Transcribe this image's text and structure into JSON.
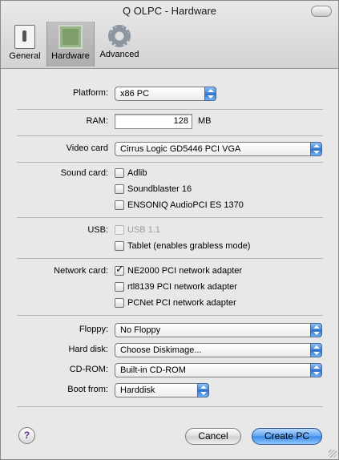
{
  "window": {
    "title": "Q OLPC - Hardware"
  },
  "toolbar": {
    "items": [
      {
        "label": "General",
        "icon": "switch-icon"
      },
      {
        "label": "Hardware",
        "icon": "chip-icon",
        "active": true
      },
      {
        "label": "Advanced",
        "icon": "gear-icon"
      }
    ]
  },
  "form": {
    "platform": {
      "label": "Platform:",
      "value": "x86 PC"
    },
    "ram": {
      "label": "RAM:",
      "value": "128",
      "unit": "MB"
    },
    "video": {
      "label": "Video card",
      "value": "Cirrus Logic GD5446 PCI VGA"
    },
    "sound": {
      "label": "Sound card:",
      "options": [
        {
          "label": "Adlib",
          "checked": false
        },
        {
          "label": "Soundblaster 16",
          "checked": false
        },
        {
          "label": "ENSONIQ AudioPCI ES 1370",
          "checked": false
        }
      ]
    },
    "usb": {
      "label": "USB:",
      "options": [
        {
          "label": "USB 1.1",
          "checked": false,
          "disabled": true
        },
        {
          "label": "Tablet (enables grabless mode)",
          "checked": false
        }
      ]
    },
    "network": {
      "label": "Network card:",
      "options": [
        {
          "label": "NE2000 PCI network adapter",
          "checked": true
        },
        {
          "label": "rtl8139 PCI network adapter",
          "checked": false
        },
        {
          "label": "PCNet PCI network adapter",
          "checked": false
        }
      ]
    },
    "floppy": {
      "label": "Floppy:",
      "value": "No Floppy"
    },
    "harddisk": {
      "label": "Hard disk:",
      "value": "Choose Diskimage..."
    },
    "cdrom": {
      "label": "CD-ROM:",
      "value": "Built-in CD-ROM"
    },
    "boot": {
      "label": "Boot from:",
      "value": "Harddisk"
    }
  },
  "buttons": {
    "help": "?",
    "cancel": "Cancel",
    "create": "Create PC"
  }
}
